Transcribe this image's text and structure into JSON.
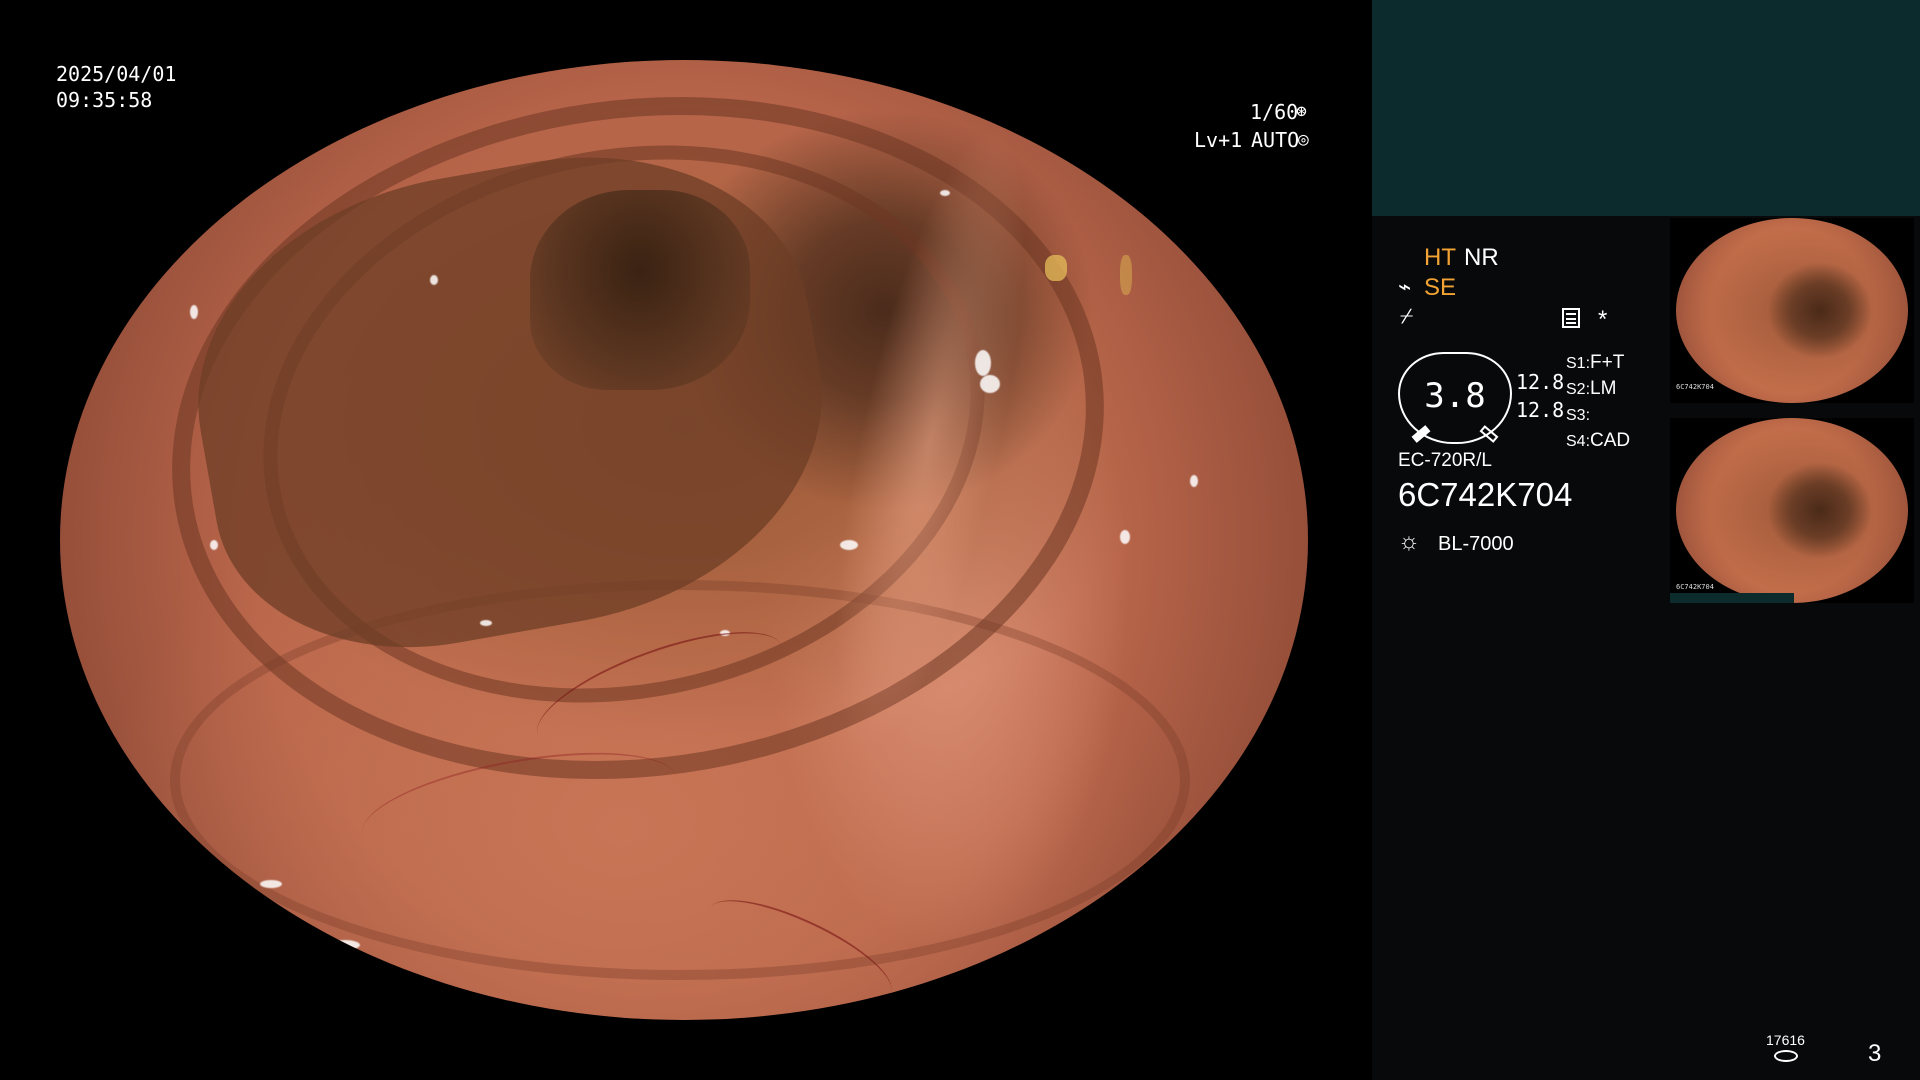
{
  "overlay": {
    "date": "2025/04/01",
    "time": "09:35:58",
    "shutter": "1/60",
    "level": "Lv+1",
    "exposure_mode": "AUTO"
  },
  "panel": {
    "ht": "HT",
    "nr": "NR",
    "se": "SE",
    "gauge_value": "3.8",
    "value_top": "12.8",
    "value_bottom": "12.8",
    "switches": [
      {
        "key": "S1",
        "value": "F+T"
      },
      {
        "key": "S2",
        "value": "LM"
      },
      {
        "key": "S3",
        "value": ""
      },
      {
        "key": "S4",
        "value": "CAD"
      }
    ],
    "scope_model": "EC-720R/L",
    "scope_serial": "6C742K704",
    "light_source": "BL-7000",
    "asterisk": "*",
    "storage_count": "17616",
    "image_count": "3"
  },
  "thumbnails": [
    {
      "serial": "6C742K704"
    },
    {
      "serial": "6C742K704"
    }
  ],
  "colors": {
    "panel_top": "#0c2b2c",
    "panel_bg": "#07090a",
    "accent_orange": "#f3a334"
  },
  "icons": [
    "shutter-icon",
    "auto-exposure-icon",
    "scope-icon",
    "freeze-icon",
    "settings-icon",
    "light-source-icon",
    "storage-icon"
  ]
}
